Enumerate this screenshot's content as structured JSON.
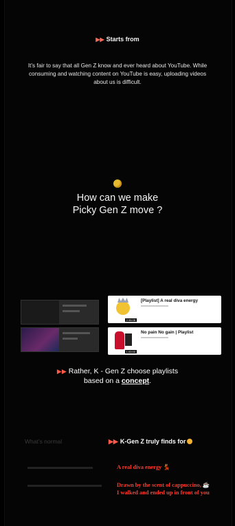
{
  "kicker": {
    "arrow": "▶▶",
    "label": "Starts from"
  },
  "intro": {
    "text": "It’s fair to say that all Gen Z know and ever heard about YouTube. While consuming and watching content on YouTube is easy, uploading videos about us is difficult."
  },
  "question": {
    "line1": "How can we make",
    "line2": "Picky Gen Z move ?"
  },
  "cards": [
    {
      "title": "[Playlist] A real diva energy",
      "duration": "2:36:08"
    },
    {
      "title": "No pain No gain | Playlist",
      "duration": "1:00:00"
    }
  ],
  "rather": {
    "arrow": "▶▶",
    "line1": "Rather, K - Gen Z choose playlists",
    "line2_prefix": "based on a ",
    "line2_link": "concept",
    "line2_suffix": "."
  },
  "comparison": {
    "left_header": "What’s normal",
    "right_header": "K-Gen Z truly finds for",
    "right_arrow": "▶▶",
    "left_rows": [
      "",
      ""
    ],
    "right_rows": [
      "A real diva energy 💃",
      "Drawn by the scent of cappuccino, ☕",
      "I walked and ended up in front of you"
    ]
  }
}
